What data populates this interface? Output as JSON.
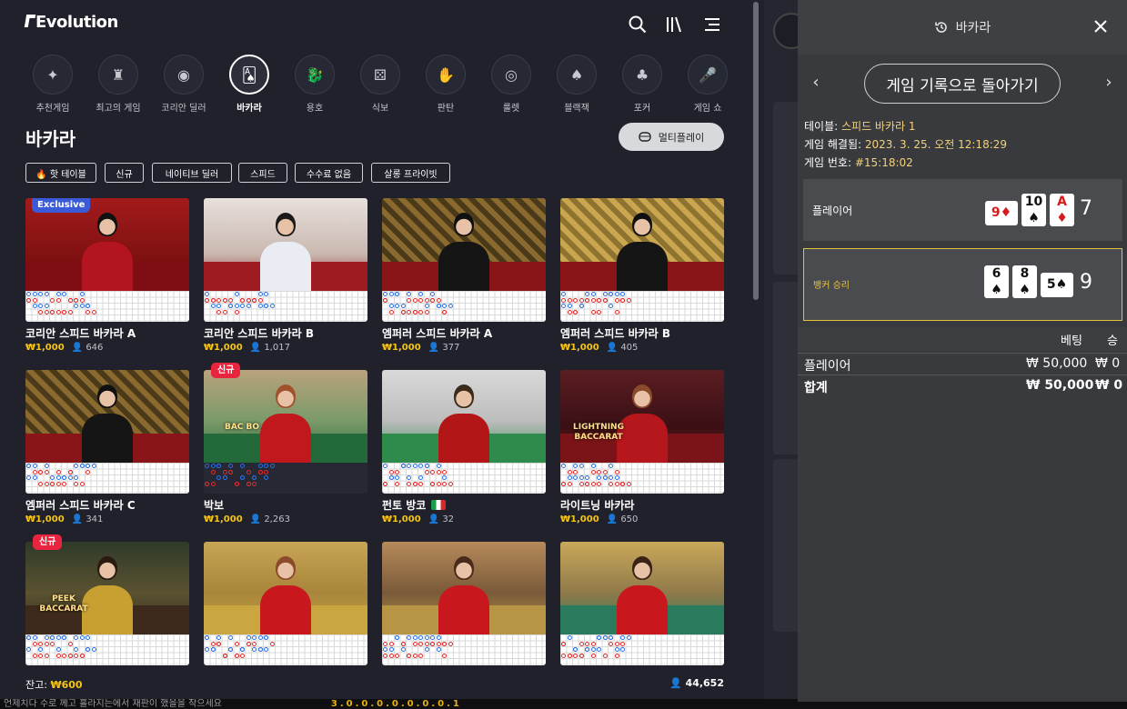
{
  "brand": {
    "logo_text": "Evolution"
  },
  "topbar": {
    "search_icon": "search-icon",
    "library_icon": "library-icon",
    "menu_icon": "menu-icon"
  },
  "categories": [
    {
      "label": "추천게임",
      "icon": "sparkles-icon",
      "glyph": "✦"
    },
    {
      "label": "최고의 게임",
      "icon": "podium-icon",
      "glyph": "♜"
    },
    {
      "label": "코리안 딜러",
      "icon": "chip-icon",
      "glyph": "◉"
    },
    {
      "label": "바카라",
      "icon": "baccarat-cards-icon",
      "glyph": "🂡",
      "active": true
    },
    {
      "label": "용호",
      "icon": "dragon-icon",
      "glyph": "🐉"
    },
    {
      "label": "식보",
      "icon": "dice-icon",
      "glyph": "⚄"
    },
    {
      "label": "판탄",
      "icon": "hands-icon",
      "glyph": "✋"
    },
    {
      "label": "룰렛",
      "icon": "roulette-icon",
      "glyph": "◎"
    },
    {
      "label": "블랙잭",
      "icon": "blackjack-icon",
      "glyph": "♠"
    },
    {
      "label": "포커",
      "icon": "poker-icon",
      "glyph": "♣"
    },
    {
      "label": "게임 쇼",
      "icon": "microphone-icon",
      "glyph": "🎤"
    }
  ],
  "section": {
    "title": "바카라",
    "multiplay_label": "멀티플레이"
  },
  "filters": [
    "🔥 핫 테이블",
    "신규",
    "네이티브 딜러",
    "스피드",
    "수수료 없음",
    "살롱 프라이빗"
  ],
  "tables": [
    {
      "name": "코리안 스피드 바카라 A",
      "bet": "₩1,000",
      "players": "646",
      "badge": "Exclusive"
    },
    {
      "name": "코리안 스피드 바카라 B",
      "bet": "₩1,000",
      "players": "1,017"
    },
    {
      "name": "엠퍼러 스피드 바카라 A",
      "bet": "₩1,000",
      "players": "377"
    },
    {
      "name": "엠퍼러 스피드 바카라 B",
      "bet": "₩1,000",
      "players": "405"
    },
    {
      "name": "엠퍼러 스피드 바카라 C",
      "bet": "₩1,000",
      "players": "341"
    },
    {
      "name": "박보",
      "bet": "₩1,000",
      "players": "2,263",
      "badge_new": "신규",
      "logo": "BAC BO"
    },
    {
      "name": "펀토 방코",
      "bet": "₩1,000",
      "players": "32"
    },
    {
      "name": "라이트닝 바카라",
      "bet": "₩1,000",
      "players": "650",
      "logo": "LIGHTNING BACCARAT"
    },
    {
      "name": "",
      "bet": "",
      "players": "",
      "badge_new": "신규",
      "logo": "PEEK BACCARAT"
    },
    {
      "name": "",
      "bet": "",
      "players": ""
    },
    {
      "name": "",
      "bet": "",
      "players": ""
    },
    {
      "name": "",
      "bet": "",
      "players": ""
    }
  ],
  "footer": {
    "balance_label": "잔고:",
    "balance_value": "₩600",
    "total_players": "44,652"
  },
  "ticker": {
    "text": "언제치다 수로 께고 흘라지는에서 재판이 했을을 작으세요",
    "gold_text": "3.0.0.0.0.0.0.0.1"
  },
  "history_panel": {
    "title": "바카라",
    "back_button": "게임 기록으로 돌아가기",
    "table_label": "테이블:",
    "table_value": "스피드 바카라 1",
    "resolved_label": "게임 해결됨:",
    "resolved_value": "2023. 3. 25. 오전 12:18:29",
    "game_no_label": "게임 번호:",
    "game_no_value": "#15:18:02",
    "player_label": "플레이어",
    "player_score": "7",
    "banker_label": "뱅커 승리",
    "banker_score": "9",
    "col_bet": "베팅",
    "col_win": "승",
    "rows": [
      {
        "label": "플레이어",
        "bet": "₩ 50,000",
        "win": "₩ 0"
      },
      {
        "label": "합계",
        "bet": "₩ 50,000",
        "win": "₩ 0"
      }
    ],
    "player_cards": [
      {
        "rank": "9",
        "suit": "♦",
        "red": true,
        "side": true
      },
      {
        "rank": "10",
        "suit": "♠",
        "red": false
      },
      {
        "rank": "A",
        "suit": "♦",
        "red": true
      }
    ],
    "banker_cards": [
      {
        "rank": "6",
        "suit": "♠",
        "red": false
      },
      {
        "rank": "8",
        "suit": "♠",
        "red": false
      },
      {
        "rank": "5",
        "suit": "♠",
        "red": false,
        "side": true
      }
    ]
  }
}
